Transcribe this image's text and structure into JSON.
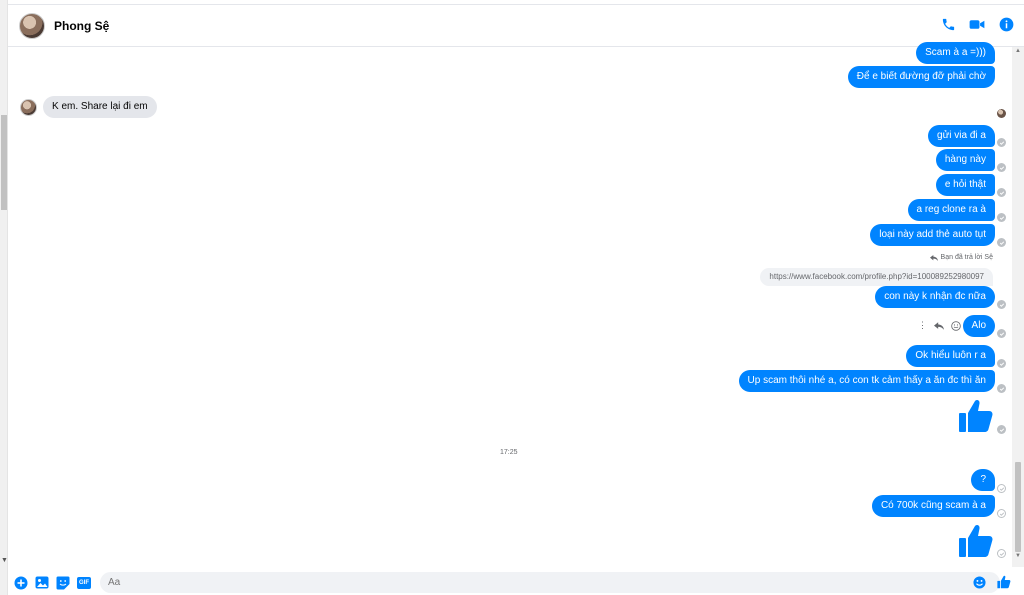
{
  "header": {
    "contact_name": "Phong Sệ",
    "icons": [
      "phone-icon",
      "video-icon",
      "info-icon"
    ]
  },
  "messages": {
    "m1": "Scam à a =)))",
    "m2": "Để e biết đường đỡ phải chờ",
    "incoming1": "K em. Share lại đi em",
    "m3": "gửi via đi a",
    "m4": "hàng này",
    "m5": "e hỏi thật",
    "m6": "a reg clone ra à",
    "m7": "loại này add thẻ auto tụt",
    "reply_note": "Bạn đã trả lời Sệ",
    "link_preview": "https://www.facebook.com/profile.php?id=100089252980097",
    "m8": "con này k nhận đc nữa",
    "m9": "Alo",
    "m10": "Ok hiểu luôn r a",
    "m11": "Up scam thôi nhé a, có con tk cảm thấy a ăn đc thì ăn",
    "timestamp": "17:25",
    "m12": "?",
    "m13": "Có 700k cũng scam à a"
  },
  "composer": {
    "placeholder": "Aa",
    "gif_label": "GIF"
  },
  "colors": {
    "accent": "#0084ff",
    "incoming_bubble": "#e4e6eb",
    "text_secondary": "#65676b"
  }
}
